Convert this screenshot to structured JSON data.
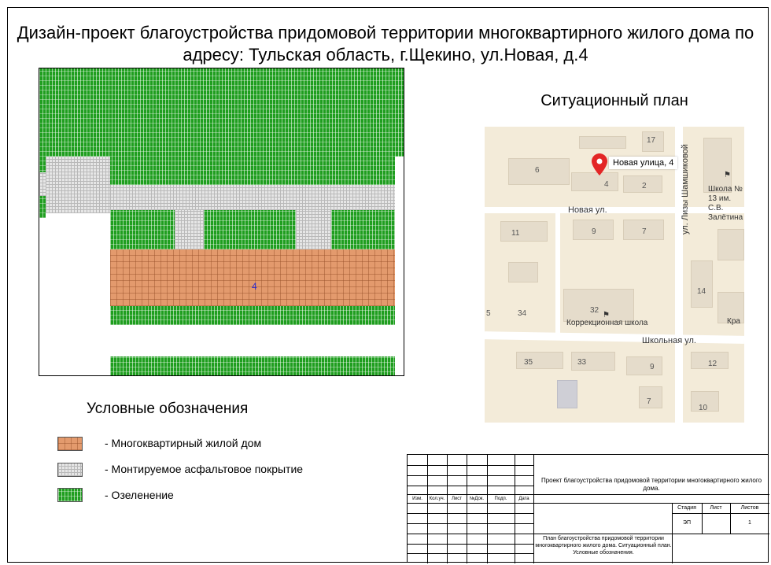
{
  "title": "Дизайн-проект благоустройства придомовой территории многоквартирного жилого дома по адресу: Тульская область, г.Щекино, ул.Новая, д.4",
  "plan": {
    "house_number": "4"
  },
  "situation": {
    "title": "Ситуационный план",
    "marker_label": "Новая улица, 4",
    "streets": {
      "novaya": "Новая ул.",
      "shkolnaya": "Школьная ул.",
      "lizy": "ул. Лизы Шамшиковой"
    },
    "numbers": [
      "17",
      "6",
      "4",
      "2",
      "11",
      "9",
      "7",
      "14",
      "5",
      "34",
      "32",
      "35",
      "33",
      "9",
      "12",
      "7",
      "10"
    ],
    "pois": {
      "school13": "Школа № 13 им. С.В. Залётина",
      "corr_school": "Коррекционная школа",
      "kra": "Кра"
    }
  },
  "legend": {
    "title": "Условные обозначения",
    "items": [
      {
        "label": "- Многоквартирный жилой дом"
      },
      {
        "label": "- Монтируемое асфальтовое покрытие"
      },
      {
        "label": "- Озеленение"
      }
    ]
  },
  "stamp": {
    "headers": [
      "Изм.",
      "Кол.уч.",
      "Лист",
      "№Док.",
      "Подп.",
      "Дата"
    ],
    "project_title": "Проект благоустройства придомовой территории многоквартирного жилого дома.",
    "stage_header": "Стадия",
    "sheet_header": "Лист",
    "sheets_header": "Листов",
    "stage_value": "ЭП",
    "sheet_value": "",
    "sheets_value": "1",
    "sheet_title": "План благоустройства придомовой территории многоквартирного жилого дома. Ситуационный план. Условные обозначения."
  },
  "colors": {
    "green": "#1f9e1f",
    "gray": "#e6e6e6",
    "orange": "#e39a6d",
    "house_number": "#2a2ad0"
  }
}
